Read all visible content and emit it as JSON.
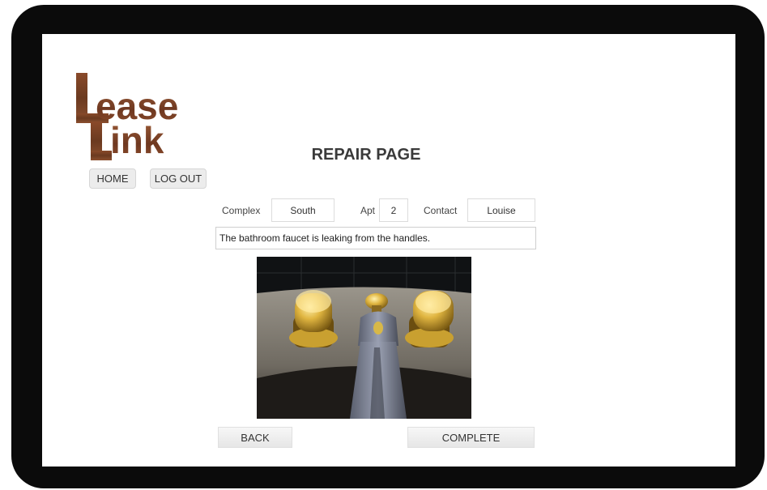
{
  "logo": {
    "line1": "ease",
    "line2": "ink"
  },
  "page": {
    "title": "REPAIR PAGE"
  },
  "nav": {
    "home_label": "HOME",
    "logout_label": "LOG OUT"
  },
  "request": {
    "complex_label": "Complex",
    "complex_value": "South",
    "apt_label": "Apt",
    "apt_value": "2",
    "contact_label": "Contact",
    "contact_value": "Louise",
    "description": "The bathroom faucet is leaking from the handles."
  },
  "actions": {
    "back_label": "BACK",
    "complete_label": "COMPLETE"
  },
  "colors": {
    "logo_brown": "#7a4128",
    "device_frame": "#0b0b0b"
  }
}
